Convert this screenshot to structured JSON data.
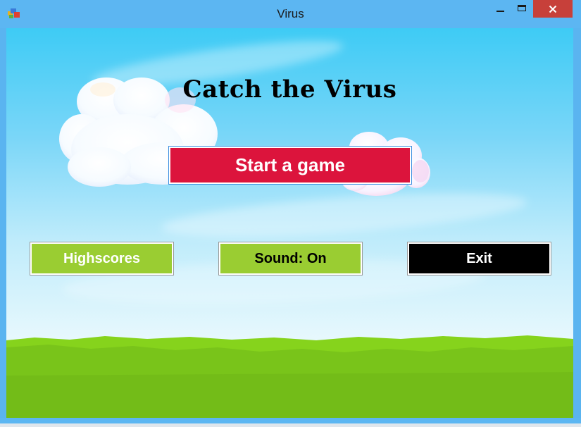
{
  "window": {
    "title": "Virus",
    "controls": {
      "minimize": "minimize-icon",
      "maximize": "maximize-icon",
      "close": "close-icon"
    }
  },
  "game": {
    "title": "Catch the Virus",
    "start_label": "Start a game",
    "highscores_label": "Highscores",
    "sound_label": "Sound: On",
    "exit_label": "Exit"
  },
  "colors": {
    "start_button": "#dc143c",
    "green_button": "#9acd32",
    "exit_button": "#000000",
    "close_button": "#c7403a",
    "titlebar": "#5cb6f2",
    "grass": "#7bc71a"
  }
}
